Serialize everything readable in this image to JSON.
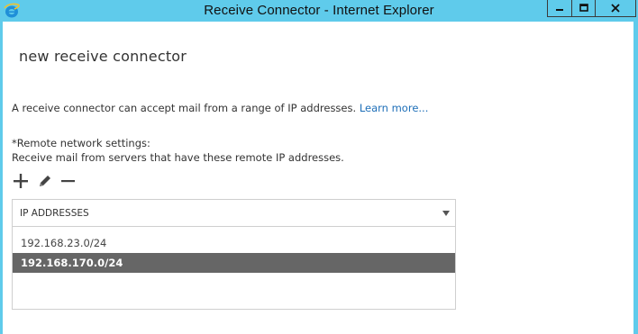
{
  "window": {
    "title": "Receive Connector - Internet Explorer",
    "app_icon": "internet-explorer-icon",
    "controls": [
      "minimize-icon",
      "maximize-icon",
      "close-icon"
    ],
    "colors": {
      "titlebar": "#5fcbeb",
      "link": "#1e6fb8",
      "selected_row": "#666666"
    }
  },
  "page": {
    "heading": "new receive connector",
    "description": "A receive connector can accept mail from a range of IP addresses.",
    "learn_more": "Learn more...",
    "remote_label": "*Remote network settings:",
    "remote_help": "Receive mail from servers that have these remote IP addresses."
  },
  "toolbar": {
    "icons": [
      "add-icon",
      "edit-icon",
      "remove-icon"
    ]
  },
  "list": {
    "column_header": "IP ADDRESSES",
    "rows": [
      "192.168.23.0/24",
      "192.168.170.0/24"
    ],
    "selected_index": 1
  }
}
